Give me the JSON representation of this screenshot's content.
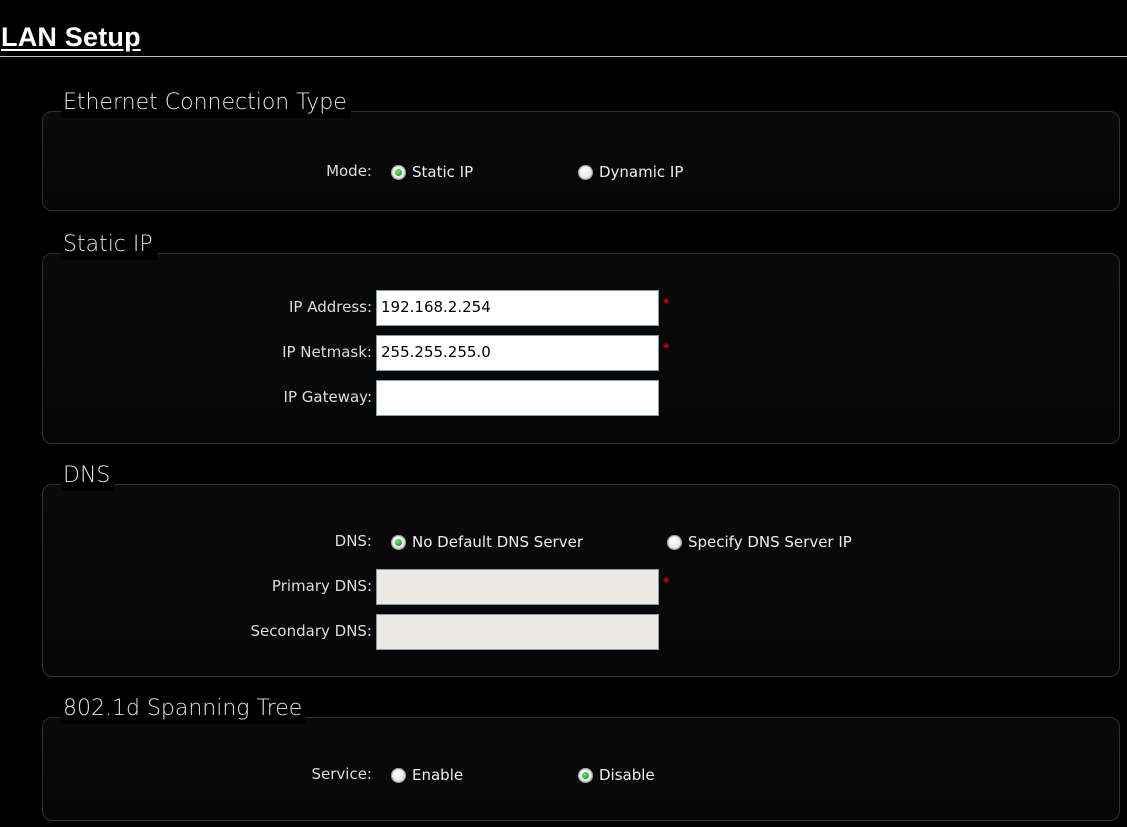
{
  "page_title": "LAN Setup",
  "sections": {
    "ethernet": {
      "legend": "Ethernet Connection Type",
      "mode_label": "Mode:",
      "options": [
        "Static IP",
        "Dynamic IP"
      ],
      "selected": "Static IP"
    },
    "static_ip": {
      "legend": "Static IP",
      "ip_address_label": "IP Address:",
      "ip_address_value": "192.168.2.254",
      "ip_netmask_label": "IP Netmask:",
      "ip_netmask_value": "255.255.255.0",
      "ip_gateway_label": "IP Gateway:",
      "ip_gateway_value": "",
      "required_mark": "*"
    },
    "dns": {
      "legend": "DNS",
      "dns_label": "DNS:",
      "options": [
        "No Default DNS Server",
        "Specify DNS Server IP"
      ],
      "selected": "No Default DNS Server",
      "primary_label": "Primary DNS:",
      "primary_value": "",
      "secondary_label": "Secondary DNS:",
      "secondary_value": "",
      "required_mark": "*"
    },
    "stp": {
      "legend": "802.1d Spanning Tree",
      "service_label": "Service:",
      "options": [
        "Enable",
        "Disable"
      ],
      "selected": "Disable"
    }
  },
  "colors": {
    "background": "#000000",
    "radio_selected": "#28a428",
    "required": "#e00000",
    "input_border": "#7f9db9"
  }
}
